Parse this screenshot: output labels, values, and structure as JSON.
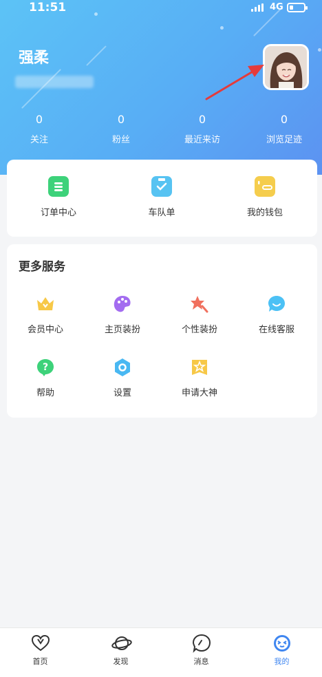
{
  "status_bar": {
    "time": "11:51",
    "network": "4G"
  },
  "profile": {
    "name": "强柔"
  },
  "stats": [
    {
      "value": "0",
      "label": "关注"
    },
    {
      "value": "0",
      "label": "粉丝"
    },
    {
      "value": "0",
      "label": "最近来访"
    },
    {
      "value": "0",
      "label": "浏览足迹"
    }
  ],
  "quick_actions": [
    {
      "label": "订单中心",
      "icon": "order-icon",
      "color": "#3dd27a"
    },
    {
      "label": "车队单",
      "icon": "clipboard-check-icon",
      "color": "#57c3f2"
    },
    {
      "label": "我的钱包",
      "icon": "wallet-icon",
      "color": "#f5cd4d"
    }
  ],
  "services": {
    "title": "更多服务",
    "items": [
      {
        "label": "会员中心",
        "icon": "crown-icon",
        "color": "#f7c847"
      },
      {
        "label": "主页装扮",
        "icon": "palette-icon",
        "color": "#a36cf0"
      },
      {
        "label": "个性装扮",
        "icon": "star-brush-icon",
        "color": "#f0705e"
      },
      {
        "label": "在线客服",
        "icon": "chat-smile-icon",
        "color": "#4cc1f5"
      },
      {
        "label": "帮助",
        "icon": "help-bubble-icon",
        "color": "#3dd27a"
      },
      {
        "label": "设置",
        "icon": "hexagon-settings-icon",
        "color": "#49b8f2"
      },
      {
        "label": "申请大神",
        "icon": "badge-star-icon",
        "color": "#f7c847"
      }
    ]
  },
  "tabbar": [
    {
      "label": "首页",
      "icon": "heart-icon",
      "active": false
    },
    {
      "label": "发现",
      "icon": "planet-icon",
      "active": false
    },
    {
      "label": "消息",
      "icon": "speech-bubble-icon",
      "active": false
    },
    {
      "label": "我的",
      "icon": "face-icon",
      "active": true
    }
  ],
  "colors": {
    "header_start": "#5cc3f6",
    "header_end": "#5c92f1",
    "active_tab": "#3f86f0",
    "annotation_arrow": "#e53b3b"
  }
}
